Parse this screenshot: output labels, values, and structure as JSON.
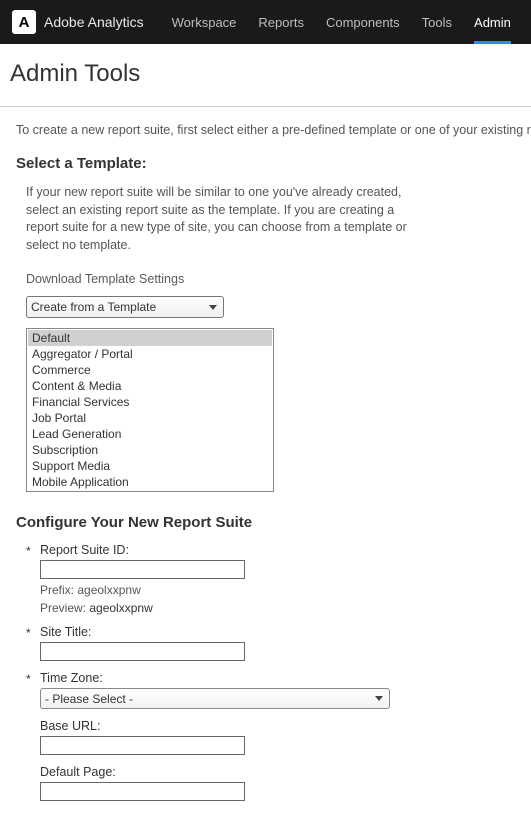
{
  "header": {
    "logo_letter": "A",
    "app_title": "Adobe Analytics",
    "nav": [
      "Workspace",
      "Reports",
      "Components",
      "Tools",
      "Admin"
    ],
    "active_nav": "Admin"
  },
  "page_title": "Admin Tools",
  "intro_text": "To create a new report suite, first select either a pre-defined template or one of your existing report suites to serve as",
  "template_section": {
    "heading": "Select a Template:",
    "help": "If your new report suite will be similar to one you've already created, select an existing report suite as the template. If you are creating a report suite for a new type of site, you can choose from a template or select no template.",
    "download_link": "Download Template Settings",
    "select_label": "Create from a Template",
    "options": [
      "Default",
      "Aggregator / Portal",
      "Commerce",
      "Content & Media",
      "Financial Services",
      "Job Portal",
      "Lead Generation",
      "Subscription",
      "Support Media",
      "Mobile Application"
    ],
    "selected_option": "Default"
  },
  "configure_section": {
    "heading": "Configure Your New Report Suite",
    "fields": {
      "report_suite_id": {
        "label": "Report Suite ID:",
        "value": "",
        "prefix_label": "Prefix:",
        "prefix_value": "ageolxxpnw",
        "preview_label": "Preview:",
        "preview_value": "ageolxxpnw"
      },
      "site_title": {
        "label": "Site Title:",
        "value": ""
      },
      "time_zone": {
        "label": "Time Zone:",
        "value": "- Please Select -"
      },
      "base_url": {
        "label": "Base URL:",
        "value": ""
      },
      "default_page": {
        "label": "Default Page:",
        "value": ""
      }
    }
  }
}
